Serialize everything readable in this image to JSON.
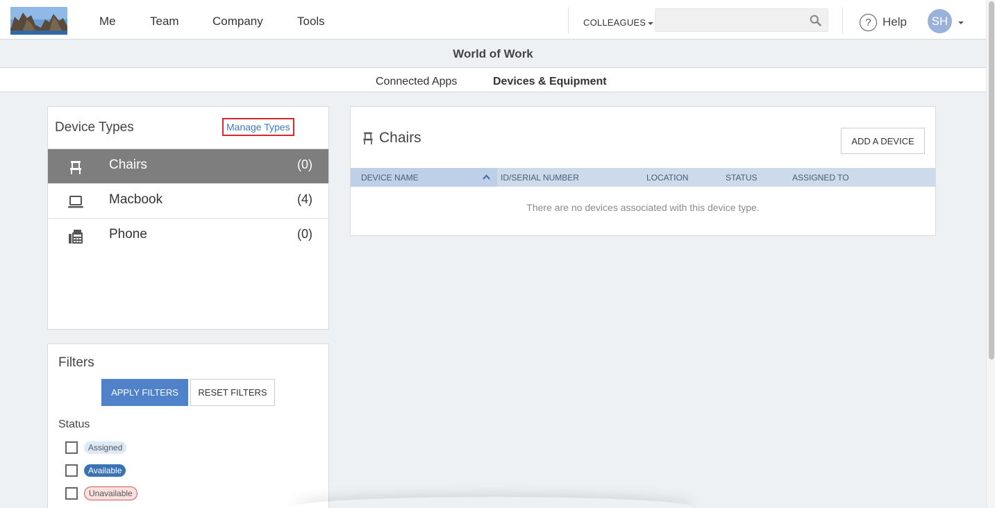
{
  "nav": {
    "links": [
      "Me",
      "Team",
      "Company",
      "Tools"
    ],
    "colleagues_label": "COLLEAGUES",
    "search_placeholder": "",
    "help_label": "Help",
    "avatar_initials": "SH"
  },
  "header": {
    "title": "World of Work",
    "tabs": [
      "Connected Apps",
      "Devices & Equipment"
    ],
    "active_tab": "Devices & Equipment"
  },
  "device_types": {
    "title": "Device Types",
    "manage_label": "Manage Types",
    "items": [
      {
        "label": "Chairs",
        "count": "(0)",
        "icon": "chair-icon",
        "selected": true
      },
      {
        "label": "Macbook",
        "count": "(4)",
        "icon": "laptop-icon",
        "selected": false
      },
      {
        "label": "Phone",
        "count": "(0)",
        "icon": "phone-icon",
        "selected": false
      }
    ]
  },
  "filters": {
    "title": "Filters",
    "apply_label": "APPLY FILTERS",
    "reset_label": "RESET FILTERS",
    "status_label": "Status",
    "statuses": [
      "Assigned",
      "Available",
      "Unavailable"
    ]
  },
  "main": {
    "title": "Chairs",
    "add_label": "ADD A DEVICE",
    "columns": [
      "DEVICE NAME",
      "ID/SERIAL NUMBER",
      "LOCATION",
      "STATUS",
      "ASSIGNED TO"
    ],
    "empty_message": "There are no devices associated with this device type."
  },
  "colors": {
    "accent": "#4f82c8",
    "selected_row": "#7e7e7e",
    "table_header": "#ccdaeb",
    "highlight_border": "#d7282f"
  }
}
